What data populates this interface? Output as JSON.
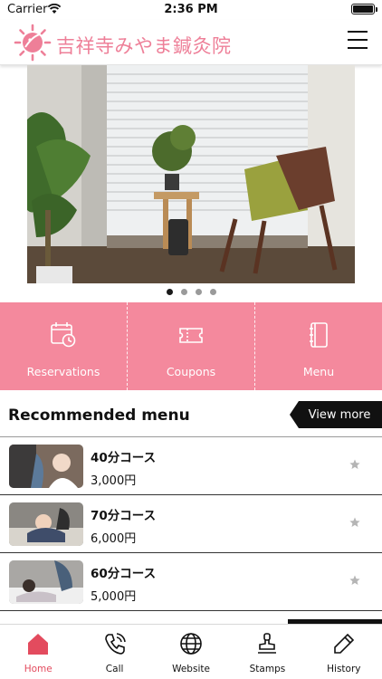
{
  "status_bar": {
    "carrier": "Carrier",
    "time": "2:36 PM"
  },
  "header": {
    "brand": "吉祥寺みやま鍼灸院"
  },
  "carousel": {
    "page_count": 4,
    "active_page": 1
  },
  "quick_menu": [
    {
      "label": "Reservations",
      "icon": "calendar-clock-icon"
    },
    {
      "label": "Coupons",
      "icon": "ticket-icon"
    },
    {
      "label": "Menu",
      "icon": "book-icon"
    }
  ],
  "recommended": {
    "title": "Recommended menu",
    "view_more": "View more",
    "items": [
      {
        "name": "40分コース",
        "price": "3,000円"
      },
      {
        "name": "70分コース",
        "price": "6,000円"
      },
      {
        "name": "60分コース",
        "price": "5,000円"
      }
    ]
  },
  "tabs": [
    {
      "label": "Home",
      "icon": "home-icon",
      "active": true
    },
    {
      "label": "Call",
      "icon": "phone-icon",
      "active": false
    },
    {
      "label": "Website",
      "icon": "globe-icon",
      "active": false
    },
    {
      "label": "Stamps",
      "icon": "stamp-icon",
      "active": false
    },
    {
      "label": "History",
      "icon": "pencil-icon",
      "active": false
    }
  ],
  "colors": {
    "brand_pink": "#f4899d",
    "active_tab": "#e34b5e",
    "text": "#111111"
  }
}
